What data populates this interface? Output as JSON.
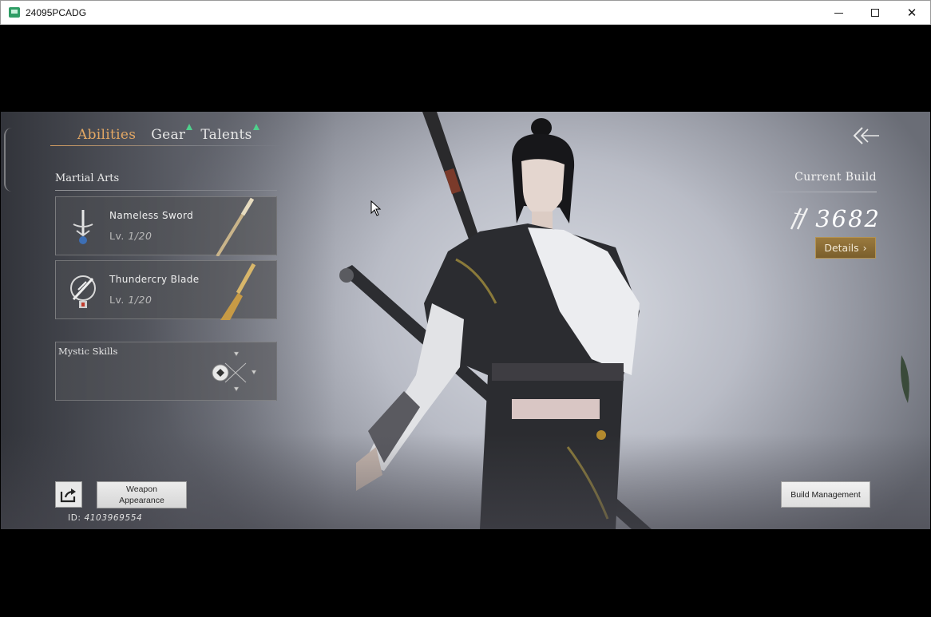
{
  "window": {
    "title": "24095PCADG"
  },
  "tabs": [
    {
      "label": "Abilities",
      "active": true,
      "badge": false
    },
    {
      "label": "Gear",
      "active": false,
      "badge": true
    },
    {
      "label": "Talents",
      "active": false,
      "badge": true
    }
  ],
  "martial_arts": {
    "label": "Martial Arts",
    "items": [
      {
        "name": "Nameless Sword",
        "level_prefix": "Lv.",
        "level": "1/20",
        "icon": "sword-school-icon",
        "weapon": "sword"
      },
      {
        "name": "Thundercry Blade",
        "level_prefix": "Lv.",
        "level": "1/20",
        "icon": "blade-school-icon",
        "weapon": "blade"
      }
    ]
  },
  "mystic_skills": {
    "label": "Mystic Skills"
  },
  "build": {
    "label": "Current Build",
    "power": "3682",
    "details_label": "Details",
    "management_label": "Build Management"
  },
  "bottom": {
    "weapon_appearance_label": "Weapon\nAppearance",
    "id_prefix": "ID:",
    "id_value": "4103969554"
  },
  "colors": {
    "tab_active": "#e2a764",
    "badge": "#4fd08c",
    "details_button": "#8a6b35"
  }
}
